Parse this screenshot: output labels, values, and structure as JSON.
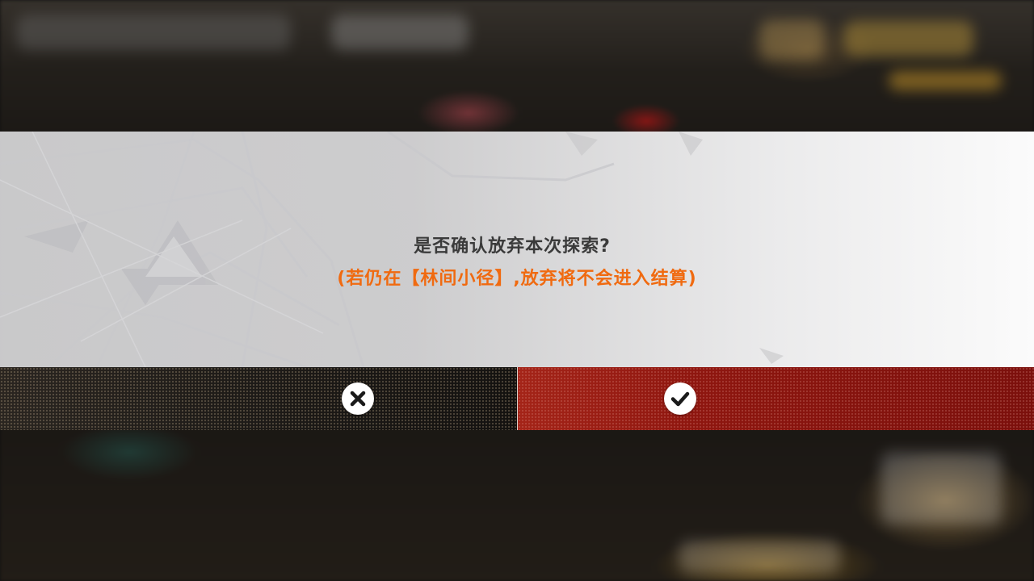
{
  "dialog": {
    "question": "是否确认放弃本次探索?",
    "note": "(若仍在【林间小径】,放弃将不会进入结算)",
    "note_color": "#f06a10"
  },
  "buttons": {
    "cancel": {
      "icon": "close-icon",
      "color": "#1e1b18"
    },
    "confirm": {
      "icon": "checkmark-icon",
      "color": "#8e160f"
    }
  }
}
